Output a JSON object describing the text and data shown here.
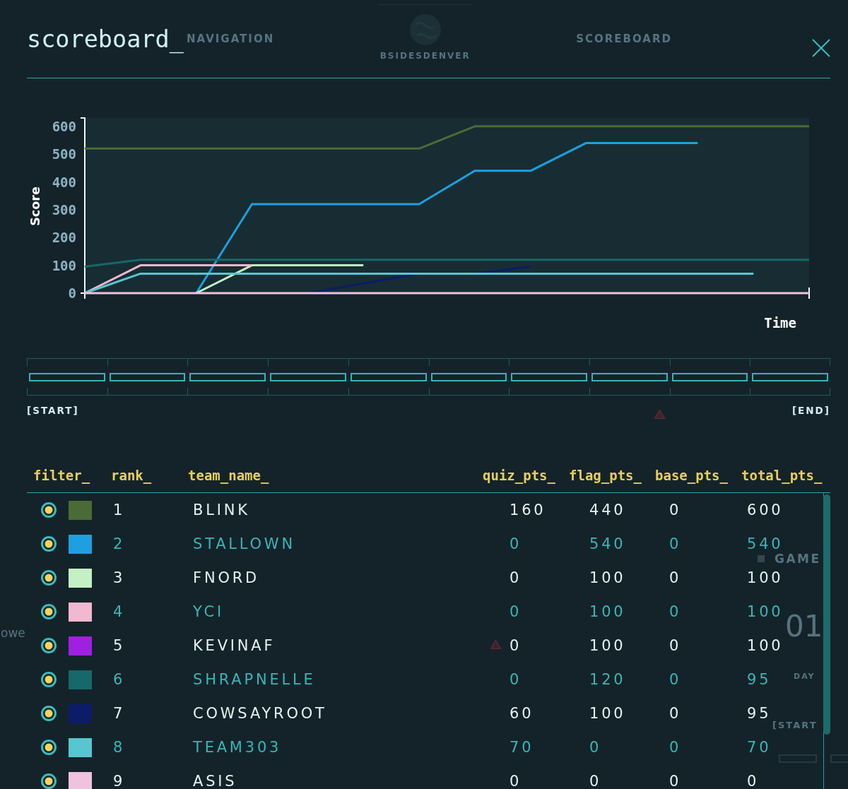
{
  "background_page": {
    "nav_left": "NAVIGATION",
    "brand": "BSIDESDENVER",
    "nav_right": "SCOREBOARD",
    "side_label": "owe",
    "game_panel": {
      "title": "GAME",
      "value": "01",
      "unit": "DAY",
      "start_label": "[START"
    }
  },
  "scoreboard": {
    "title": "scoreboard_",
    "chart_data": {
      "type": "line",
      "xlabel": "Time",
      "ylabel": "Score",
      "categories": [
        null,
        null,
        null,
        null,
        null,
        null,
        null,
        null,
        null,
        null,
        null,
        null,
        null,
        null
      ],
      "ylim": [
        0,
        630
      ],
      "yticks": [
        0,
        100,
        200,
        300,
        400,
        500,
        600
      ],
      "series": [
        {
          "color": "#4a6b35",
          "values": [
            520,
            520,
            520,
            520,
            520,
            520,
            520,
            600,
            600,
            600,
            600,
            600,
            600,
            600
          ]
        },
        {
          "color": "#1ea0e0",
          "values": [
            null,
            null,
            0,
            320,
            320,
            320,
            320,
            440,
            440,
            540,
            540,
            540,
            null,
            null
          ]
        },
        {
          "color": "#c4f0c4",
          "values": [
            null,
            null,
            0,
            100,
            100,
            100,
            null,
            null,
            null,
            null,
            null,
            null,
            null,
            null
          ]
        },
        {
          "color": "#f2b8cf",
          "values": [
            0,
            100,
            100,
            100,
            null,
            null,
            null,
            null,
            null,
            null,
            null,
            null,
            null,
            null
          ]
        },
        {
          "color": "#176868",
          "values": [
            95,
            120,
            120,
            120,
            120,
            120,
            120,
            120,
            120,
            120,
            120,
            120,
            120,
            120
          ]
        },
        {
          "color": "#0c1c68",
          "values": [
            null,
            null,
            null,
            null,
            0,
            35,
            70,
            70,
            95,
            null,
            null,
            null,
            null,
            null
          ]
        },
        {
          "color": "#58c6d0",
          "values": [
            0,
            70,
            70,
            70,
            70,
            70,
            70,
            70,
            70,
            70,
            70,
            70,
            70,
            null
          ]
        },
        {
          "color": "#f0c2df",
          "values": [
            0,
            0,
            0,
            0,
            0,
            0,
            0,
            0,
            0,
            0,
            0,
            0,
            0,
            0
          ]
        }
      ]
    },
    "timeline": {
      "start_label": "[START]",
      "end_label": "[END]"
    },
    "table": {
      "columns": [
        "filter_",
        "rank_",
        "team_name_",
        "quiz_pts_",
        "flag_pts_",
        "base_pts_",
        "total_pts_"
      ],
      "rows": [
        {
          "checked": true,
          "color": "#4a6b35",
          "rank": "1",
          "team_name": "BLINK",
          "quiz_pts": "160",
          "flag_pts": "440",
          "base_pts": "0",
          "total_pts": "600"
        },
        {
          "checked": true,
          "color": "#1ea0e0",
          "rank": "2",
          "team_name": "STALLOWN",
          "quiz_pts": "0",
          "flag_pts": "540",
          "base_pts": "0",
          "total_pts": "540"
        },
        {
          "checked": true,
          "color": "#c4f0c4",
          "rank": "3",
          "team_name": "FNORD",
          "quiz_pts": "0",
          "flag_pts": "100",
          "base_pts": "0",
          "total_pts": "100"
        },
        {
          "checked": true,
          "color": "#f2b8cf",
          "rank": "4",
          "team_name": "YCI",
          "quiz_pts": "0",
          "flag_pts": "100",
          "base_pts": "0",
          "total_pts": "100"
        },
        {
          "checked": true,
          "color": "#a020e0",
          "rank": "5",
          "team_name": "KEVINAF",
          "quiz_pts": "0",
          "flag_pts": "100",
          "base_pts": "0",
          "total_pts": "100"
        },
        {
          "checked": true,
          "color": "#176868",
          "rank": "6",
          "team_name": "SHRAPNELLE",
          "quiz_pts": "0",
          "flag_pts": "120",
          "base_pts": "0",
          "total_pts": "95"
        },
        {
          "checked": true,
          "color": "#0c1c68",
          "rank": "7",
          "team_name": "COWSAYROOT",
          "quiz_pts": "60",
          "flag_pts": "100",
          "base_pts": "0",
          "total_pts": "95"
        },
        {
          "checked": true,
          "color": "#58c6d0",
          "rank": "8",
          "team_name": "TEAM303",
          "quiz_pts": "70",
          "flag_pts": "0",
          "base_pts": "0",
          "total_pts": "70"
        },
        {
          "checked": true,
          "color": "#f0c2df",
          "rank": "9",
          "team_name": "ASIS",
          "quiz_pts": "0",
          "flag_pts": "0",
          "base_pts": "0",
          "total_pts": "0"
        }
      ]
    }
  }
}
